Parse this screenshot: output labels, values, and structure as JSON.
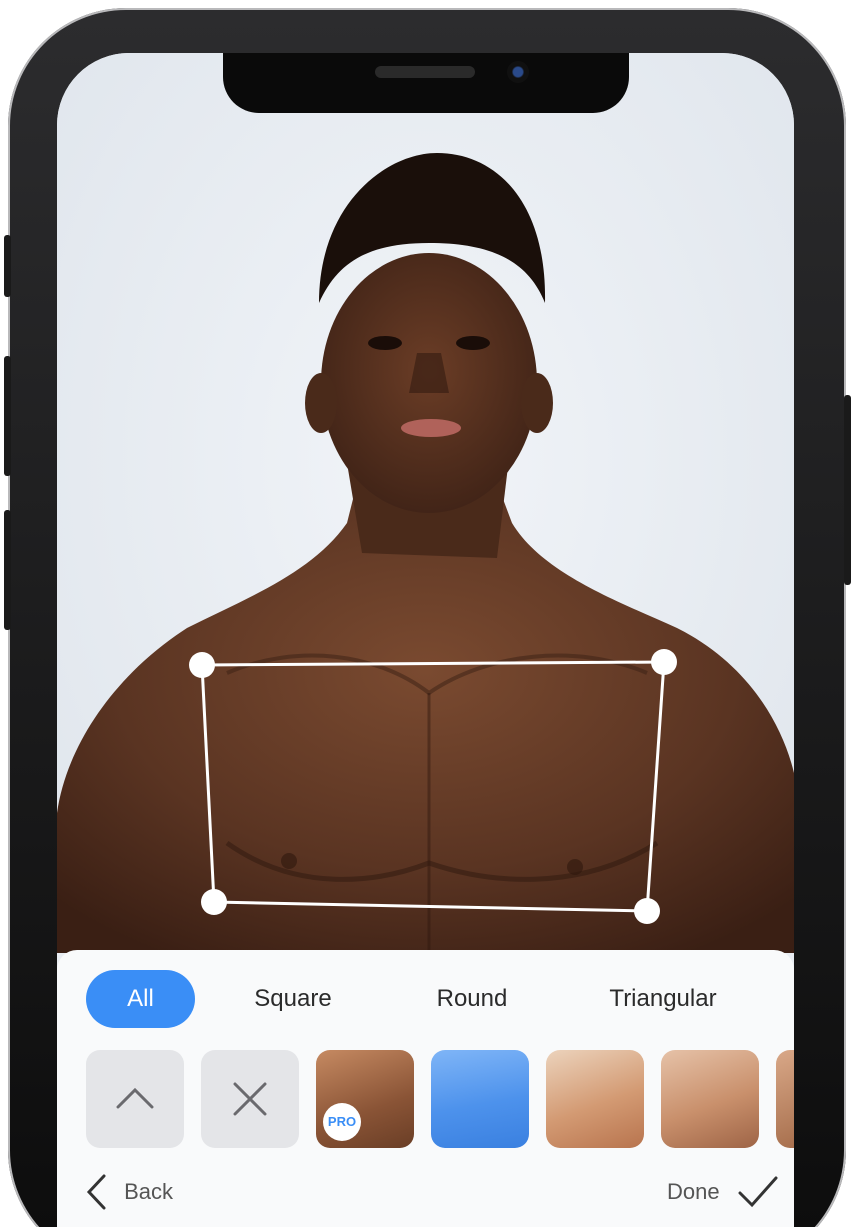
{
  "tabs": [
    {
      "label": "All",
      "active": true
    },
    {
      "label": "Square",
      "active": false
    },
    {
      "label": "Round",
      "active": false
    },
    {
      "label": "Triangular",
      "active": false
    }
  ],
  "thumbnails": [
    {
      "icon": "chevron-up-icon"
    },
    {
      "icon": "close-icon"
    },
    {
      "badge": "PRO"
    },
    {},
    {},
    {},
    {}
  ],
  "nav": {
    "back_label": "Back",
    "done_label": "Done"
  },
  "colors": {
    "accent": "#3a8ef6",
    "panel": "#f9fafb",
    "skin": "#5a3422"
  }
}
